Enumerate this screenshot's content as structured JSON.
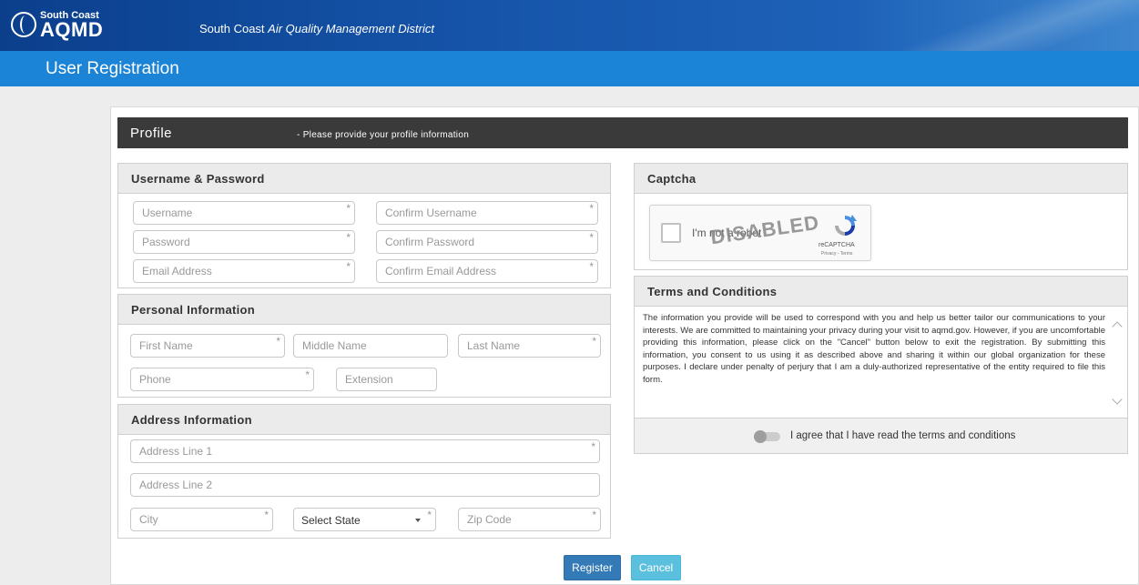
{
  "header": {
    "logo_small": "South Coast",
    "logo_big": "AQMD",
    "agency_plain": "South Coast",
    "agency_italic": "Air Quality Management District"
  },
  "page_title": "User Registration",
  "profile": {
    "title": "Profile",
    "subtitle": "- Please provide your profile information"
  },
  "username_password": {
    "heading": "Username & Password",
    "username": "Username",
    "confirm_username": "Confirm Username",
    "password": "Password",
    "confirm_password": "Confirm Password",
    "email": "Email Address",
    "confirm_email": "Confirm Email Address"
  },
  "personal": {
    "heading": "Personal Information",
    "first_name": "First Name",
    "middle_name": "Middle Name",
    "last_name": "Last Name",
    "phone": "Phone",
    "extension": "Extension"
  },
  "address": {
    "heading": "Address Information",
    "line1": "Address Line 1",
    "line2": "Address Line 2",
    "city": "City",
    "state_selected": "Select State",
    "zip": "Zip Code"
  },
  "required_marker": "*",
  "captcha": {
    "heading": "Captcha",
    "checkbox_label": "I'm not a robot",
    "overlay": "DISABLED",
    "brand": "reCAPTCHA",
    "links": "Privacy - Terms"
  },
  "terms": {
    "heading": "Terms and Conditions",
    "text": "The information you provide will be used to correspond with you and help us better tailor our communications to your interests. We are committed to maintaining your privacy during your visit to aqmd.gov. However, if you are uncomfortable providing this information, please click on the \"Cancel\" button below to exit the registration. By submitting this information, you consent to us using it as described above and sharing it within our global organization for these purposes. I declare under penalty of perjury that I am a duly-authorized representative of the entity required to file this form.",
    "agree_label": "I agree that I have read the terms and conditions"
  },
  "buttons": {
    "register": "Register",
    "cancel": "Cancel"
  },
  "colors": {
    "header_blue": "#1553a8",
    "title_bar_blue": "#1b84d6",
    "profile_bar": "#3a3a3a",
    "register_button": "#337ab7",
    "cancel_button": "#5bc0de"
  }
}
